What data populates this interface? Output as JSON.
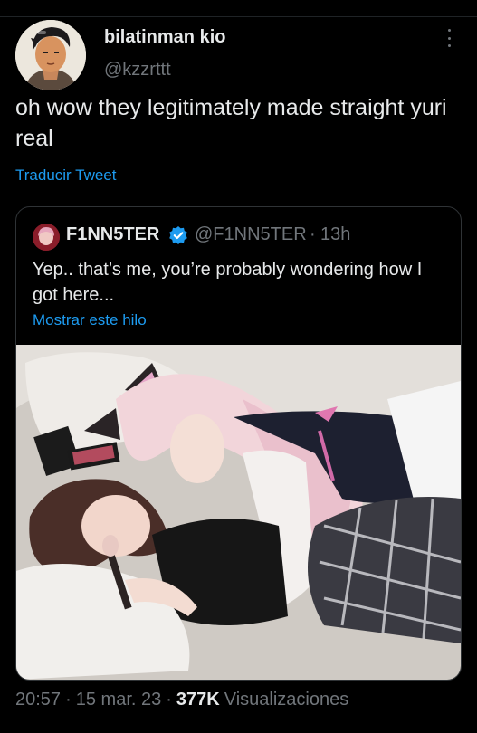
{
  "tweet": {
    "author": {
      "display_name": "bilatinman kio",
      "handle": "@kzzrttt",
      "avatar_icon": "avatar-illustration"
    },
    "menu_icon": "more-options-icon",
    "text": "oh wow they legitimately made straight yuri real",
    "translate_label": "Traducir Tweet",
    "quoted": {
      "display_name": "F1NN5TER",
      "verified_icon": "verified-badge-icon",
      "handle": "@F1NN5TER",
      "separator": "·",
      "time": "13h",
      "text": "Yep.. that’s me, you’re probably wondering how I got here...",
      "thread_label": "Mostrar este hilo",
      "photo": "quoted-media-photo"
    },
    "meta": {
      "time": "20:57",
      "sep1": "·",
      "date": "15 mar. 23",
      "sep2": "·",
      "views_count": "377K",
      "views_label": "Visualizaciones"
    }
  },
  "colors": {
    "background": "#000000",
    "text": "#e7e9ea",
    "secondary": "#71767b",
    "link": "#1d9bf0",
    "border": "#2f3336"
  }
}
